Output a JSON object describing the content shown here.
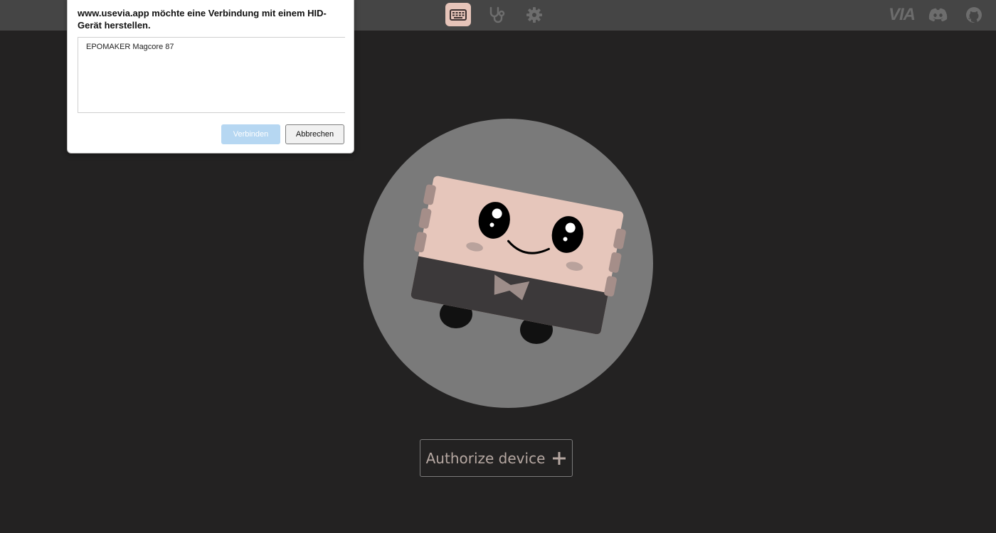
{
  "topbar": {
    "nav": [
      {
        "icon": "keyboard-icon",
        "active": true
      },
      {
        "icon": "stethoscope-icon",
        "active": false
      },
      {
        "icon": "gear-icon",
        "active": false
      }
    ],
    "right_icons": {
      "via_logo": "VIA",
      "discord": "discord-icon",
      "github": "github-icon"
    }
  },
  "dialog": {
    "title": "www.usevia.app möchte eine Verbindung mit einem HID-Gerät herstellen.",
    "devices": [
      "EPOMAKER Magcore 87"
    ],
    "connect_label": "Verbinden",
    "cancel_label": "Abbrechen"
  },
  "main": {
    "authorize_label": "Authorize device",
    "authorize_icon": "plus-icon"
  },
  "colors": {
    "background": "#232222",
    "topbar": "#454545",
    "accent": "#e6c4b9",
    "connect_disabled": "#b6d7f2"
  }
}
